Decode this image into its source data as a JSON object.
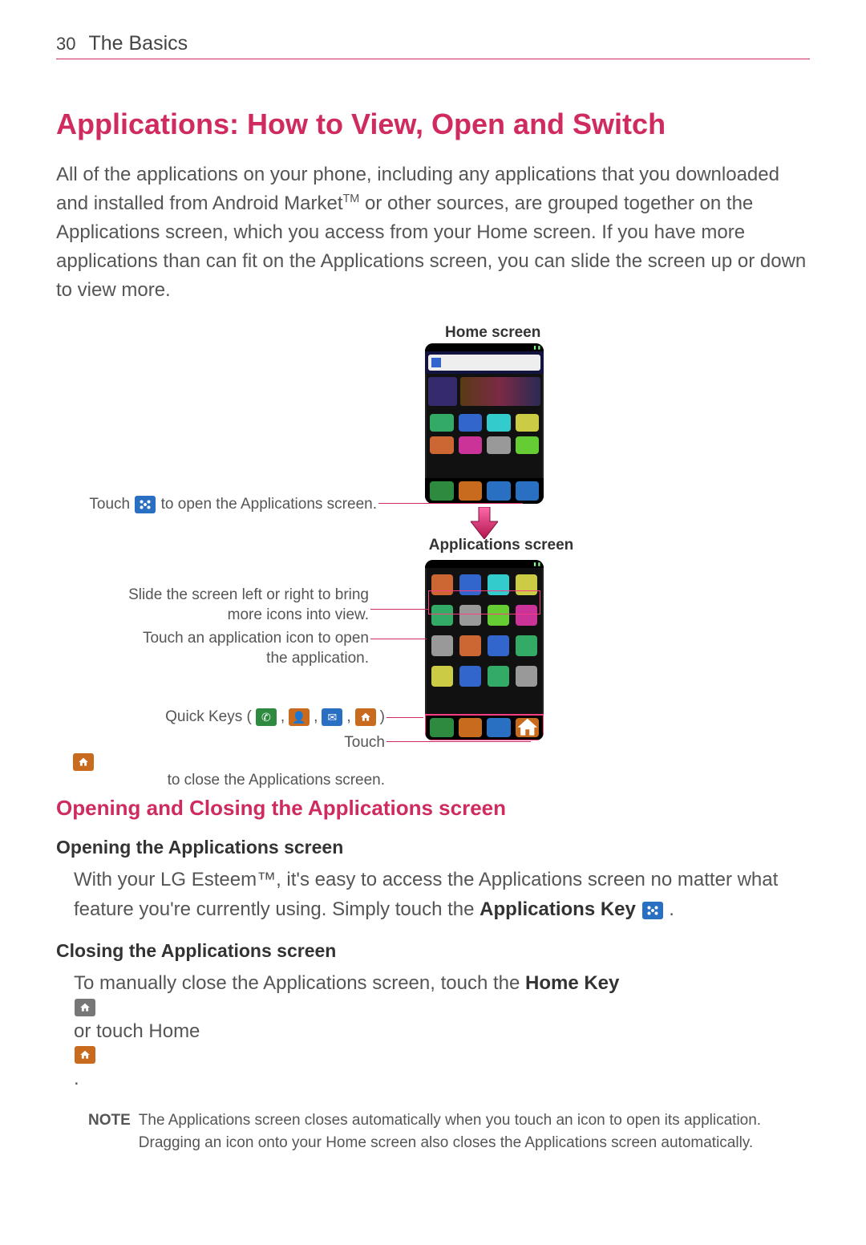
{
  "header": {
    "page_number": "30",
    "chapter": "The Basics"
  },
  "title": "Applications: How to View, Open and Switch",
  "intro_a": "All of the applications on your phone, including any applications that you downloaded and installed from Android Market",
  "intro_tm": "TM",
  "intro_b": " or other sources, are grouped together on the Applications screen, which you access from your Home screen. If you have more applications than can fit on the Applications screen, you can slide the screen up or down to view more.",
  "captions": {
    "home_screen": "Home screen",
    "apps_screen": "Applications screen"
  },
  "callouts": {
    "touch_open_a": "Touch ",
    "touch_open_b": " to open the Applications screen.",
    "slide": "Slide the screen left or right to bring more icons into view.",
    "touch_icon": "Touch an application icon to open the application.",
    "quick_keys": "Quick Keys (",
    "quick_keys_end": ")",
    "sep": ", ",
    "touch_close_a": "Touch ",
    "touch_close_b": " to close the Applications screen."
  },
  "sections": {
    "s1_title": "Opening and Closing the Applications screen",
    "opening_title": "Opening the Applications screen",
    "opening_a": "With your LG Esteem™, it's easy to access the Applications screen no matter what feature you're currently using. Simply touch the ",
    "opening_bold": "Applications Key",
    "opening_b": " .",
    "closing_title": "Closing the Applications screen",
    "closing_a": "To manually close the Applications screen, touch the ",
    "closing_bold": "Home Key",
    "closing_b": " or touch Home ",
    "closing_c": "."
  },
  "note": {
    "label": "NOTE",
    "text": "The Applications screen closes automatically when you touch an icon to open its application. Dragging an icon onto your Home screen also closes the Applications screen automatically."
  }
}
